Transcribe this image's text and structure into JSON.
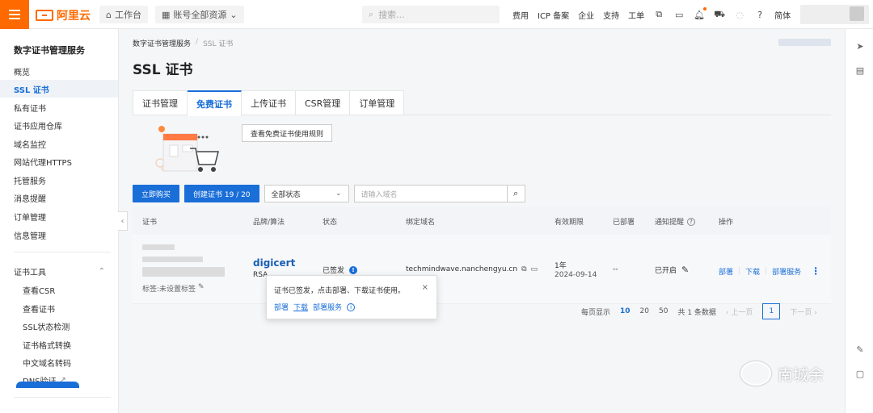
{
  "topbar": {
    "logo_text": "阿里云",
    "workbench": "工作台",
    "account_resources": "账号全部资源",
    "search_placeholder": "搜索...",
    "nav": [
      "费用",
      "ICP 备案",
      "企业",
      "支持",
      "工单"
    ],
    "lang": "简体"
  },
  "sidebar": {
    "title": "数字证书管理服务",
    "items": [
      "概览",
      "SSL 证书",
      "私有证书",
      "证书应用仓库",
      "域名监控",
      "网站代理HTTPS",
      "托管服务",
      "消息提醒",
      "订单管理",
      "信息管理"
    ],
    "tools_title": "证书工具",
    "tools": [
      "查看CSR",
      "查看证书",
      "SSL状态检测",
      "证书格式转换",
      "中文域名转码",
      "DNS验证"
    ]
  },
  "breadcrumb": {
    "root": "数字证书管理服务",
    "sep": "/",
    "current": "SSL 证书"
  },
  "page_title": "SSL 证书",
  "tabs": [
    "证书管理",
    "免费证书",
    "上传证书",
    "CSR管理",
    "订单管理"
  ],
  "rules_button": "查看免费证书使用规则",
  "toolbar": {
    "buy": "立即购买",
    "create": "创建证书 19 / 20",
    "status_select": "全部状态",
    "domain_placeholder": "请输入域名"
  },
  "table": {
    "headers": [
      "证书",
      "品牌/算法",
      "状态",
      "绑定域名",
      "有效期限",
      "已部署",
      "通知提醒",
      "操作"
    ],
    "row": {
      "tag": "标签:未设置标签",
      "brand": "digicert",
      "algo": "RSA",
      "status": "已签发",
      "domain": "techmindwave.nanchengyu.cn",
      "validity_term": "1年",
      "validity_date": "2024-09-14",
      "deployed": "--",
      "notify": "已开启",
      "actions": [
        "部署",
        "下载",
        "部署服务"
      ]
    }
  },
  "pagination": {
    "per_page_label": "每页显示",
    "sizes": [
      "10",
      "20",
      "50"
    ],
    "total": "共 1 条数据",
    "prev": "上一页",
    "page": "1",
    "next": "下一页"
  },
  "popover": {
    "message": "证书已签发，点击部署、下载证书使用。",
    "actions": [
      "部署",
      "下载",
      "部署服务"
    ],
    "close": "×"
  },
  "watermark": "南城余",
  "colors": {
    "accent": "#1a6ed8",
    "brand": "#ff6a00"
  }
}
